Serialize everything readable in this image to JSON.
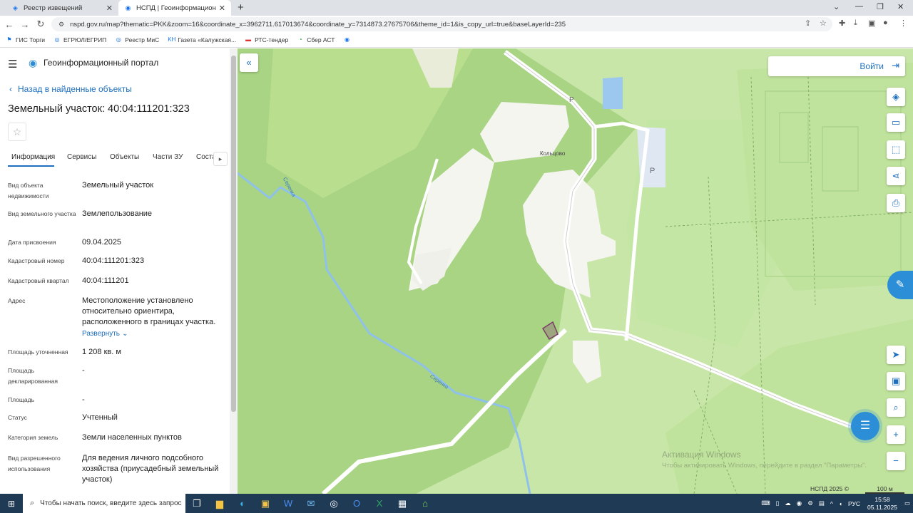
{
  "browser": {
    "tabs": [
      {
        "title": "Реестр извещений",
        "active": false
      },
      {
        "title": "НСПД | Геоинформационный п",
        "active": true
      }
    ],
    "url": "nspd.gov.ru/map?thematic=PKK&zoom=16&coordinate_x=3962711.617013674&coordinate_y=7314873.27675706&theme_id=1&is_copy_url=true&baseLayerId=235",
    "bookmarks": [
      "ГИС Торги",
      "ЕГРЮЛ/ЕГРИП",
      "Реестр МиС",
      "Газета «Калужская...",
      "РТС-тендер",
      "Сбер АСТ"
    ]
  },
  "sidebar": {
    "portal_title": "Геоинформационный портал",
    "back_label": "Назад в найденные объекты",
    "object_title": "Земельный участок: 40:04:111201:323",
    "tabs": [
      "Информация",
      "Сервисы",
      "Объекты",
      "Части ЗУ",
      "Соста"
    ],
    "active_tab": "Информация",
    "expand_label": "Развернуть",
    "fields": [
      {
        "label": "Вид объекта недвижимости",
        "value": "Земельный участок"
      },
      {
        "label": "Вид земельного участка",
        "value": "Землепользование"
      },
      {
        "label": "Дата присвоения",
        "value": "09.04.2025"
      },
      {
        "label": "Кадастровый номер",
        "value": "40:04:111201:323"
      },
      {
        "label": "Кадастровый квартал",
        "value": "40:04:111201"
      },
      {
        "label": "Адрес",
        "value": "Местоположение установлено относительно ориентира, расположенного в границах участка."
      },
      {
        "label": "Площадь уточненная",
        "value": "1 208 кв. м"
      },
      {
        "label": "Площадь декларированная",
        "value": "-"
      },
      {
        "label": "Площадь",
        "value": "-"
      },
      {
        "label": "Статус",
        "value": "Учтенный"
      },
      {
        "label": "Категория земель",
        "value": "Земли населенных пунктов"
      },
      {
        "label": "Вид разрешенного использования",
        "value": "Для ведения личного подсобного хозяйства (приусадебный земельный участок)"
      }
    ]
  },
  "map": {
    "login_label": "Войти",
    "place_label": "Кольцово",
    "river_label": "Серенка",
    "parking_label": "P",
    "watermark_line1": "Активация Windows",
    "watermark_line2": "Чтобы активировать Windows, перейдите в раздел \"Параметры\".",
    "footer": "НСПД 2025 ©",
    "scale": "100 м"
  },
  "taskbar": {
    "search_placeholder": "Чтобы начать поиск, введите здесь запрос",
    "lang": "РУС",
    "time": "15:58",
    "date": "05.11.2025"
  }
}
